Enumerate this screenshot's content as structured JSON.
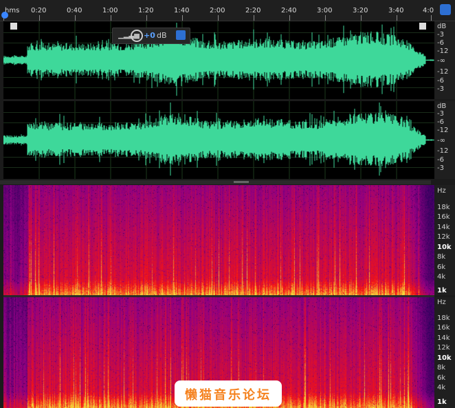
{
  "ruler": {
    "ticks": [
      "hms",
      "0:20",
      "0:40",
      "1:00",
      "1:20",
      "1:40",
      "2:00",
      "2:20",
      "2:40",
      "3:00",
      "3:20",
      "3:40",
      "4:0"
    ]
  },
  "waveform": {
    "db_labels_top": [
      "dB",
      "-3",
      "-6",
      "-12",
      "-∞",
      "-12",
      "-6",
      "-3"
    ],
    "db_labels_bottom": [
      "dB",
      "-3",
      "-6",
      "-12",
      "-∞",
      "-12",
      "-6",
      "-3"
    ],
    "color": "#3ed89a"
  },
  "hud": {
    "signal_icon": "▁▂▃▅",
    "gain": "+0",
    "unit": "dB"
  },
  "spectrogram": {
    "hz_labels": [
      "Hz",
      "18k",
      "16k",
      "14k",
      "12k",
      "10k",
      "8k",
      "6k",
      "4k",
      "1k"
    ],
    "bold_labels": [
      "10k",
      "1k"
    ]
  },
  "watermark": {
    "text": "懒猫音乐论坛"
  }
}
